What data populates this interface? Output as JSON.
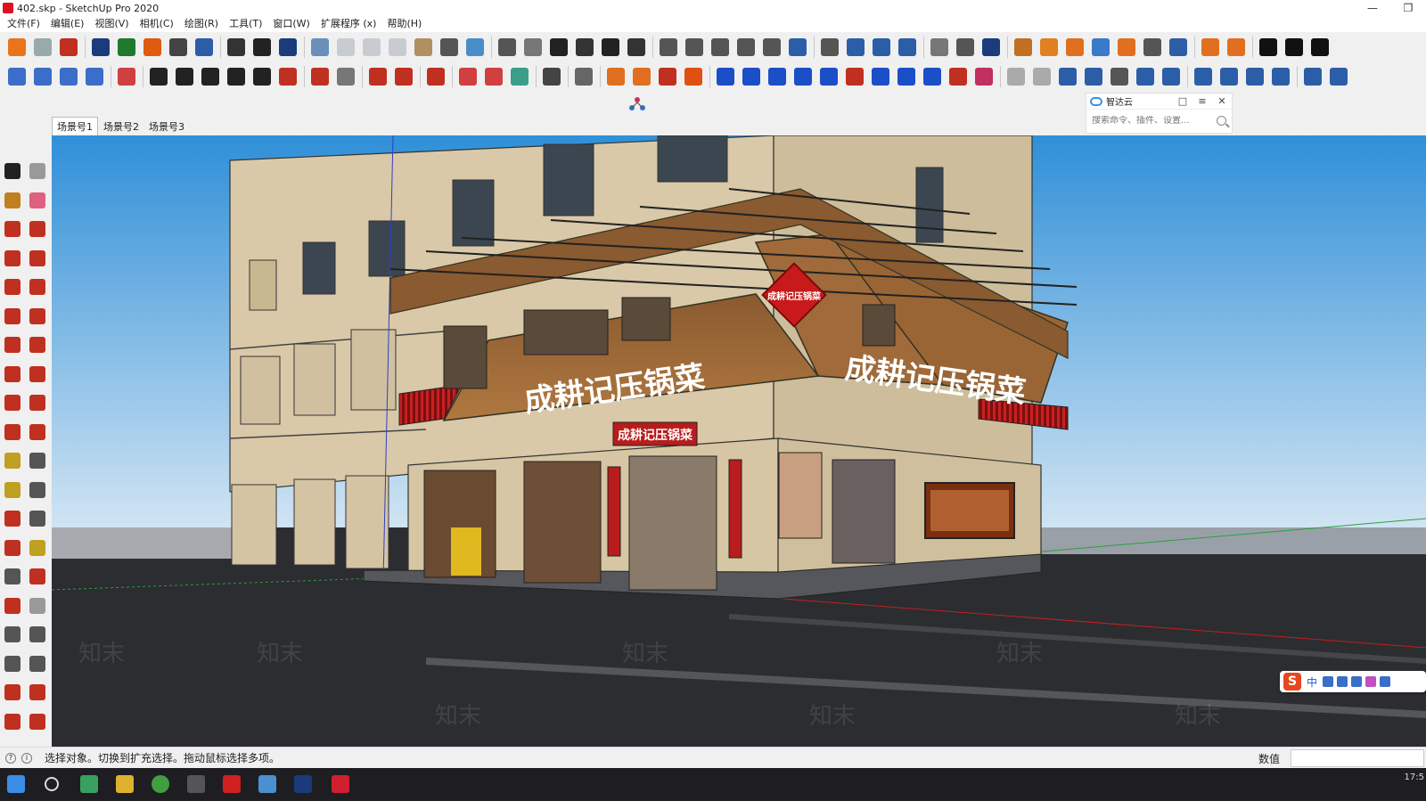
{
  "window": {
    "title": "402.skp - SketchUp Pro 2020",
    "controls": [
      "—",
      "❐"
    ]
  },
  "menu": [
    "文件(F)",
    "编辑(E)",
    "视图(V)",
    "相机(C)",
    "绘图(R)",
    "工具(T)",
    "窗口(W)",
    "扩展程序 (x)",
    "帮助(H)"
  ],
  "toolbar1": [
    {
      "icon": "sketchup-logo-icon",
      "color": "#e8741c"
    },
    {
      "icon": "refresh-icon",
      "color": "#9aa"
    },
    {
      "icon": "layers-stack-icon",
      "color": "#c03020"
    },
    {
      "sep": true
    },
    {
      "icon": "add-circle-icon",
      "color": "#1a3c7a"
    },
    {
      "icon": "tree-icon",
      "color": "#1f7a2e"
    },
    {
      "icon": "warehouse-icon",
      "color": "#e05a10"
    },
    {
      "icon": "checker-icon",
      "color": "#444"
    },
    {
      "icon": "cloud-upload-icon",
      "color": "#2c5ea8"
    },
    {
      "sep": true
    },
    {
      "icon": "gear-icon",
      "color": "#333"
    },
    {
      "icon": "mail-icon",
      "color": "#222"
    },
    {
      "icon": "info-icon",
      "color": "#1a3c7a"
    },
    {
      "sep": true
    },
    {
      "icon": "iso-view-icon",
      "color": "#6a8fb8"
    },
    {
      "icon": "top-view-icon",
      "color": "#c8ccd0"
    },
    {
      "icon": "front-view-icon",
      "color": "#c8ccd0"
    },
    {
      "icon": "right-view-icon",
      "color": "#c8ccd0"
    },
    {
      "icon": "back-view-icon",
      "color": "#b09060"
    },
    {
      "icon": "left-view-icon",
      "color": "#555"
    },
    {
      "icon": "bottom-view-icon",
      "color": "#4a8ec8"
    },
    {
      "sep": true
    },
    {
      "icon": "xray-icon",
      "color": "#555"
    },
    {
      "icon": "wireframe-icon",
      "color": "#777"
    },
    {
      "icon": "house-icon",
      "color": "#222"
    },
    {
      "icon": "hidden-line-icon",
      "color": "#333"
    },
    {
      "icon": "shaded-icon",
      "color": "#222"
    },
    {
      "icon": "textured-icon",
      "color": "#333"
    },
    {
      "sep": true
    },
    {
      "icon": "solid-union-icon",
      "color": "#555"
    },
    {
      "icon": "solid-intersect-icon",
      "color": "#555"
    },
    {
      "icon": "solid-subtract-icon",
      "color": "#555"
    },
    {
      "icon": "solid-trim-icon",
      "color": "#555"
    },
    {
      "icon": "solid-split-icon",
      "color": "#555"
    },
    {
      "icon": "outer-shell-icon",
      "color": "#2c5ea8"
    },
    {
      "sep": true
    },
    {
      "icon": "axes-icon",
      "color": "#555"
    },
    {
      "icon": "section-plane-icon",
      "color": "#2c5ea8"
    },
    {
      "icon": "section-display-icon",
      "color": "#2c5ea8"
    },
    {
      "icon": "section-cut-icon",
      "color": "#2c5ea8"
    },
    {
      "sep": true
    },
    {
      "icon": "pencil-line-icon",
      "color": "#777"
    },
    {
      "icon": "dimension-icon",
      "color": "#555"
    },
    {
      "icon": "rotate-arrows-icon",
      "color": "#1a3c7a"
    },
    {
      "sep": true
    },
    {
      "icon": "sandbox-icon",
      "color": "#c07020"
    },
    {
      "icon": "stamp-icon",
      "color": "#e08020"
    },
    {
      "icon": "drape-icon",
      "color": "#e07020"
    },
    {
      "icon": "smoove-icon",
      "color": "#3a7ac8"
    },
    {
      "icon": "flip-edge-icon",
      "color": "#e07020"
    },
    {
      "icon": "scissors-icon",
      "color": "#555"
    },
    {
      "icon": "link-icon",
      "color": "#2c5ea8"
    },
    {
      "sep": true
    },
    {
      "icon": "component-a-icon",
      "color": "#e07020"
    },
    {
      "icon": "component-b-icon",
      "color": "#e07020"
    },
    {
      "sep": true
    },
    {
      "icon": "zhimo-logo-icon",
      "color": "#111"
    },
    {
      "icon": "swirl-icon",
      "color": "#111"
    },
    {
      "icon": "brush-icon",
      "color": "#111"
    }
  ],
  "toolbar2": [
    {
      "icon": "eyedropper-icon",
      "color": "#3a6ec8"
    },
    {
      "icon": "camera-icon",
      "color": "#3a6ec8"
    },
    {
      "icon": "layers-icon",
      "color": "#3a6ec8"
    },
    {
      "icon": "layers-alt-icon",
      "color": "#3a6ec8"
    },
    {
      "sep": true
    },
    {
      "icon": "mirror-icon",
      "color": "#d04040"
    },
    {
      "sep": true
    },
    {
      "icon": "line-icon",
      "color": "#222"
    },
    {
      "icon": "rectangle-icon",
      "color": "#222"
    },
    {
      "icon": "rotated-rect-icon",
      "color": "#222"
    },
    {
      "icon": "polygon-icon",
      "color": "#222"
    },
    {
      "icon": "circle-icon",
      "color": "#222"
    },
    {
      "icon": "arc-icon",
      "color": "#c03020"
    },
    {
      "sep": true
    },
    {
      "icon": "select-arrow-icon",
      "color": "#c03020"
    },
    {
      "icon": "box-icon",
      "color": "#777"
    },
    {
      "sep": true
    },
    {
      "icon": "eraser-pencil-icon",
      "color": "#c03020"
    },
    {
      "icon": "cursor-icon",
      "color": "#c03020"
    },
    {
      "sep": true
    },
    {
      "icon": "paint-icon",
      "color": "#c03020"
    },
    {
      "sep": true
    },
    {
      "icon": "push-pull-icon",
      "color": "#d04040"
    },
    {
      "icon": "offset-icon",
      "color": "#d04040"
    },
    {
      "icon": "follow-me-icon",
      "color": "#3a9e88"
    },
    {
      "sep": true
    },
    {
      "icon": "hammer-icon",
      "color": "#444"
    },
    {
      "sep": true
    },
    {
      "icon": "component-cube-icon",
      "color": "#666"
    },
    {
      "sep": true
    },
    {
      "icon": "import-icon",
      "color": "#e07020"
    },
    {
      "icon": "export-icon",
      "color": "#e07020"
    },
    {
      "icon": "render-icon",
      "color": "#c03020"
    },
    {
      "icon": "render-settings-icon",
      "color": "#e05010"
    },
    {
      "sep": true
    },
    {
      "icon": "blue-shape-icon",
      "color": "#1a4fc8"
    },
    {
      "icon": "blue-cube-a-icon",
      "color": "#1a4fc8"
    },
    {
      "icon": "blue-cube-b-icon",
      "color": "#1a4fc8"
    },
    {
      "icon": "blue-bar-icon",
      "color": "#1a4fc8"
    },
    {
      "icon": "blue-arrows-a-icon",
      "color": "#1a4fc8"
    },
    {
      "icon": "blue-arrows-b-icon",
      "color": "#c03020"
    },
    {
      "icon": "blue-line-icon",
      "color": "#1a4fc8"
    },
    {
      "icon": "blue-hourglass-icon",
      "color": "#1a4fc8"
    },
    {
      "icon": "hook-a-icon",
      "color": "#1a4fc8"
    },
    {
      "icon": "hook-b-icon",
      "color": "#c03020"
    },
    {
      "icon": "tag-icon",
      "color": "#c03060"
    },
    {
      "sep": true
    },
    {
      "icon": "undo-icon",
      "color": "#aaa"
    },
    {
      "icon": "redo-icon",
      "color": "#aaa"
    },
    {
      "icon": "stripes-icon",
      "color": "#2c5ea8"
    },
    {
      "icon": "dot-icon",
      "color": "#2c5ea8"
    },
    {
      "icon": "square-outline-icon",
      "color": "#555"
    },
    {
      "icon": "checkbox-icon",
      "color": "#2c5ea8"
    },
    {
      "icon": "spiral-icon",
      "color": "#2c5ea8"
    },
    {
      "sep": true
    },
    {
      "icon": "cloud-sync-icon",
      "color": "#2c5ea8"
    },
    {
      "icon": "cloud-share-icon",
      "color": "#2c5ea8"
    },
    {
      "icon": "cloud-a-icon",
      "color": "#2c5ea8"
    },
    {
      "icon": "cloud-b-icon",
      "color": "#2c5ea8"
    },
    {
      "sep": true
    },
    {
      "icon": "frame-icon",
      "color": "#2c5ea8"
    },
    {
      "icon": "network-icon",
      "color": "#2c5ea8"
    }
  ],
  "plugin_center_icon": {
    "icon": "plugin-hub-icon",
    "color": "#d03060"
  },
  "zhida": {
    "name": "智达云",
    "search_placeholder": "搜索命令、插件、设置..."
  },
  "scenes": [
    "场景号1",
    "场景号2",
    "场景号3"
  ],
  "lefttools": [
    {
      "icon": "select-icon",
      "color": "#222"
    },
    {
      "icon": "make-component-icon",
      "color": "#999"
    },
    {
      "icon": "paint-bucket-icon",
      "color": "#c08020"
    },
    {
      "icon": "eraser-icon",
      "color": "#e06080"
    },
    {
      "icon": "pencil-icon",
      "color": "#c03020"
    },
    {
      "icon": "freehand-icon",
      "color": "#c03020"
    },
    {
      "icon": "rectangle-tool-icon",
      "color": "#c03020"
    },
    {
      "icon": "rotated-rectangle-tool-icon",
      "color": "#c03020"
    },
    {
      "icon": "circle-tool-icon",
      "color": "#c03020"
    },
    {
      "icon": "polygon-tool-icon",
      "color": "#c03020"
    },
    {
      "icon": "arc-tool-icon",
      "color": "#c03020"
    },
    {
      "icon": "two-point-arc-icon",
      "color": "#c03020"
    },
    {
      "icon": "three-point-arc-icon",
      "color": "#c03020"
    },
    {
      "icon": "pie-icon",
      "color": "#c03020"
    },
    {
      "icon": "move-icon",
      "color": "#c03020"
    },
    {
      "icon": "push-pull-tool-icon",
      "color": "#c03020"
    },
    {
      "icon": "rotate-icon",
      "color": "#c03020"
    },
    {
      "icon": "follow-me-tool-icon",
      "color": "#c03020"
    },
    {
      "icon": "scale-icon",
      "color": "#c03020"
    },
    {
      "icon": "offset-tool-icon",
      "color": "#c03020"
    },
    {
      "icon": "tape-measure-icon",
      "color": "#c0a020"
    },
    {
      "icon": "dimension-tool-icon",
      "color": "#555"
    },
    {
      "icon": "protractor-icon",
      "color": "#c0a020"
    },
    {
      "icon": "text-tool-icon",
      "color": "#555"
    },
    {
      "icon": "axes-tool-icon",
      "color": "#c03020"
    },
    {
      "icon": "3d-text-icon",
      "color": "#555"
    },
    {
      "icon": "orbit-icon",
      "color": "#c03020"
    },
    {
      "icon": "pan-icon",
      "color": "#c0a020"
    },
    {
      "icon": "zoom-icon",
      "color": "#555"
    },
    {
      "icon": "zoom-window-icon",
      "color": "#c03020"
    },
    {
      "icon": "zoom-extents-icon",
      "color": "#c03020"
    },
    {
      "icon": "previous-view-icon",
      "color": "#999"
    },
    {
      "icon": "position-camera-icon",
      "color": "#555"
    },
    {
      "icon": "look-around-icon",
      "color": "#555"
    },
    {
      "icon": "walk-icon",
      "color": "#555"
    },
    {
      "icon": "section-tool-icon",
      "color": "#555"
    },
    {
      "icon": "warehouse-tool-icon",
      "color": "#c03020"
    },
    {
      "icon": "extension-warehouse-icon",
      "color": "#c03020"
    },
    {
      "icon": "send-layout-icon",
      "color": "#c03020"
    },
    {
      "icon": "extension-manager-icon",
      "color": "#c03020"
    }
  ],
  "viewport": {
    "storefront_sign": "成耕记压锅菜",
    "sign_small": "成耕记压锅菜",
    "diamond_sign": "成耕记压锅菜",
    "watermark": "知末"
  },
  "colors": {
    "sky": "#4aa3e0",
    "ground": "#2c2d30",
    "wall": "#d8c8a8",
    "roof": "#a06a3a",
    "accent_red": "#b81c1c"
  },
  "status": {
    "message": "选择对象。切换到扩充选择。拖动鼠标选择多项。",
    "measure_label": "数值",
    "measure_value": ""
  },
  "ime": {
    "lang": "中"
  },
  "taskbar": {
    "clock": "17:5"
  }
}
